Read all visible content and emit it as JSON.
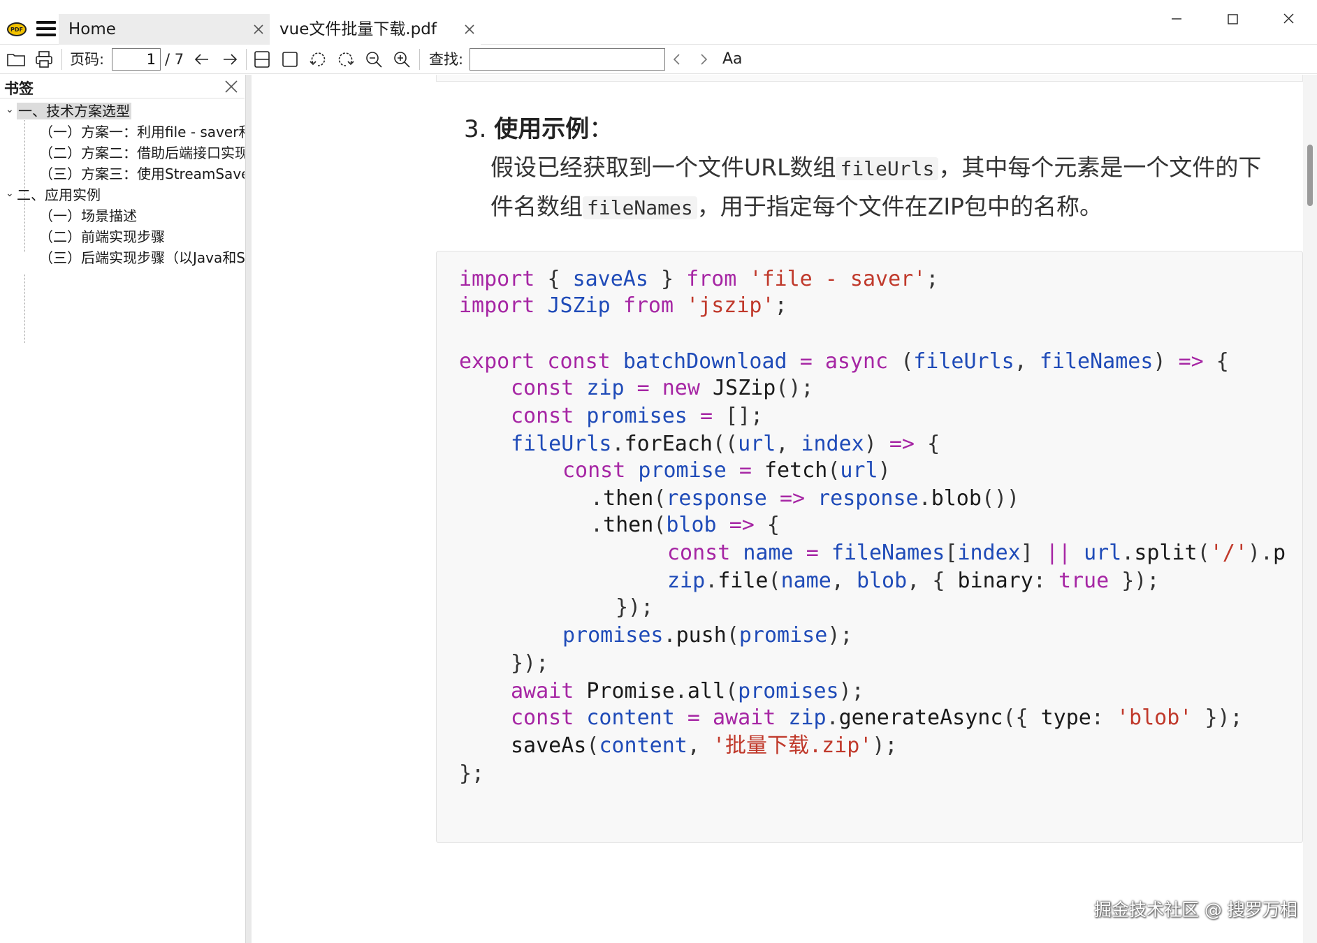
{
  "window": {
    "tabs": [
      {
        "label": "Home"
      },
      {
        "label": "vue文件批量下载.pdf"
      }
    ]
  },
  "toolbar": {
    "page_label": "页码:",
    "page_value": "1",
    "page_total": "/ 7",
    "search_label": "查找:",
    "search_value": "",
    "font_label": "Aa"
  },
  "sidebar": {
    "title": "书签",
    "items": [
      {
        "label": "一、技术方案选型"
      },
      {
        "label": "（一）方案一：利用file - saver和"
      },
      {
        "label": "（二）方案二：借助后端接口实现"
      },
      {
        "label": "（三）方案三：使用StreamSaver"
      },
      {
        "label": "二、应用实例"
      },
      {
        "label": "（一）场景描述"
      },
      {
        "label": "（二）前端实现步骤"
      },
      {
        "label": "（三）后端实现步骤（以Java和S"
      }
    ]
  },
  "document": {
    "heading_number": "3.",
    "heading_bold": "使用示例",
    "heading_colon": "：",
    "para1_a": "假设已经获取到一个文件URL数组",
    "para1_code": "fileUrls",
    "para1_b": "，其中每个元素是一个文件的下",
    "para2_a": "件名数组",
    "para2_code": "fileNames",
    "para2_b": "，用于指定每个文件在ZIP包中的名称。"
  },
  "watermark": "掘金技术社区 @ 搜罗万相",
  "colors": {
    "keyword": "#a626a4",
    "string": "#c0392b",
    "variable": "#1f4bb8"
  }
}
